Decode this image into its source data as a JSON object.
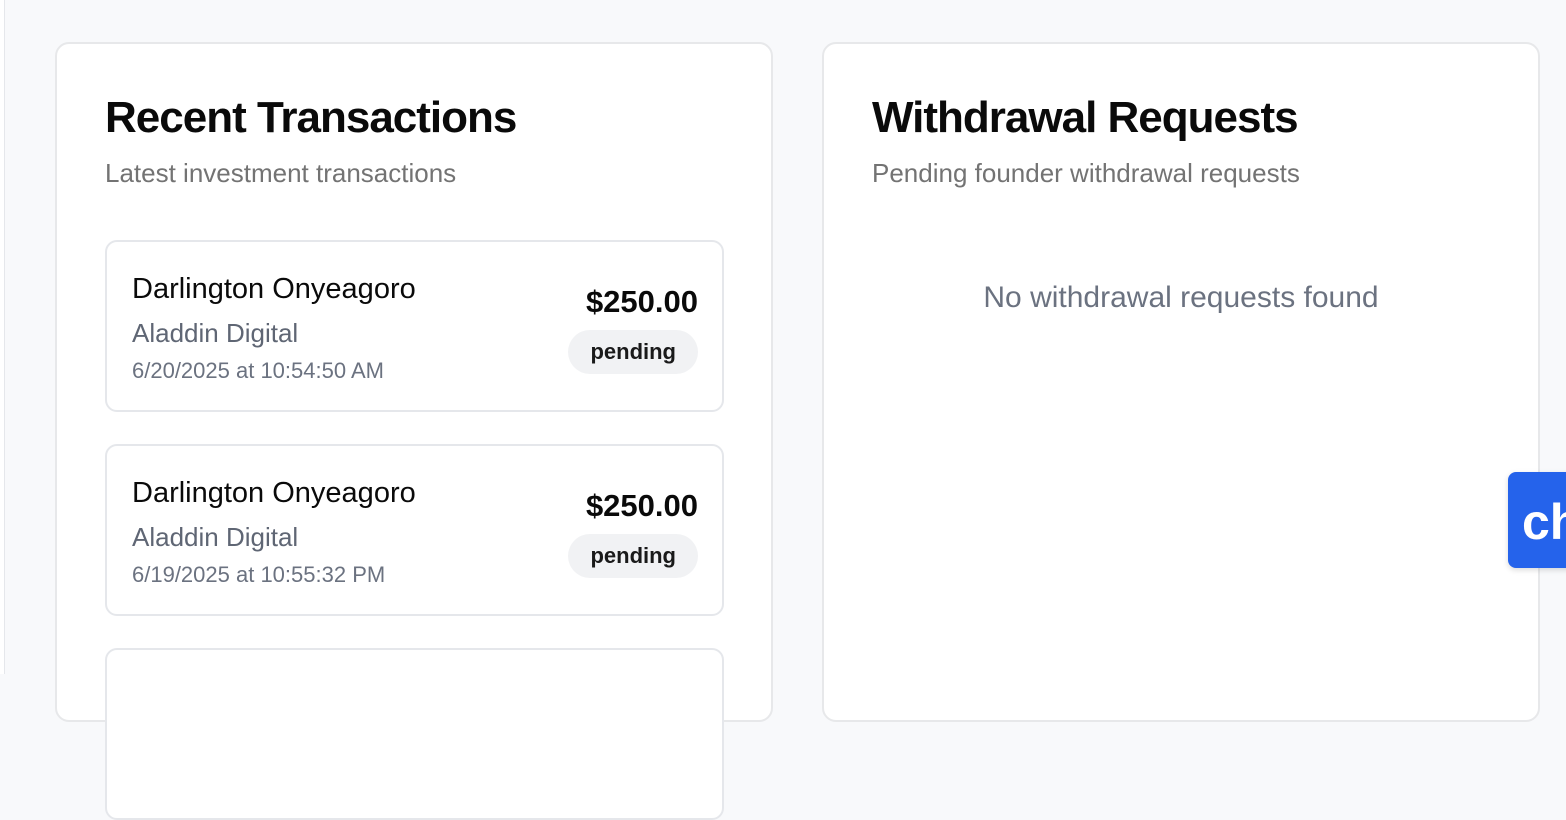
{
  "transactions_card": {
    "title": "Recent Transactions",
    "subtitle": "Latest investment transactions",
    "items": [
      {
        "name": "Darlington Onyeagoro",
        "company": "Aladdin Digital",
        "date": "6/20/2025 at 10:54:50 AM",
        "amount": "$250.00",
        "status": "pending"
      },
      {
        "name": "Darlington Onyeagoro",
        "company": "Aladdin Digital",
        "date": "6/19/2025 at 10:55:32 PM",
        "amount": "$250.00",
        "status": "pending"
      }
    ]
  },
  "withdrawals_card": {
    "title": "Withdrawal Requests",
    "subtitle": "Pending founder withdrawal requests",
    "empty_message": "No withdrawal requests found"
  },
  "chat_widget": {
    "glyph": "ch",
    "icon": "chat-launcher-icon",
    "color": "#2563eb"
  },
  "colors": {
    "page_background": "#f8f9fb",
    "card_background": "#ffffff",
    "badge_background": "#f1f2f4",
    "muted_text": "#737373"
  }
}
